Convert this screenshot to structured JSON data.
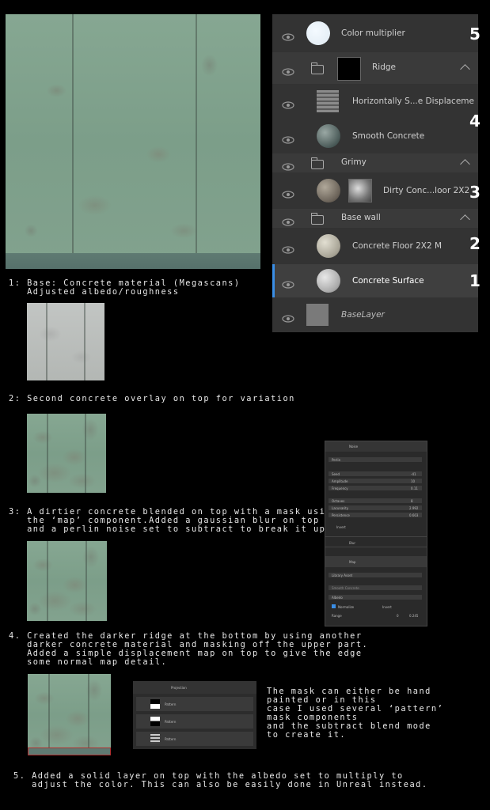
{
  "layers": {
    "color_multiplier": "Color multiplier",
    "ridge": "Ridge",
    "horiz_disp": "Horizontally S...e Displaceme",
    "smooth_concrete": "Smooth Concrete",
    "grimy": "Grimy",
    "dirty_concrete": "Dirty Conc...loor 2X2",
    "base_wall": "Base wall",
    "concrete_floor": "Concrete Floor 2X2 M",
    "concrete_surface": "Concrete Surface",
    "base_layer": "BaseLayer"
  },
  "markers": {
    "m5": "5",
    "m4": "4",
    "m3": "3",
    "m2": "2",
    "m1": "1"
  },
  "steps": {
    "s1": "1: Base: Concrete material (Megascans)\n   Adjusted albedo/roughness",
    "s2": "2: Second concrete overlay on top for variation",
    "s3": "3: A dirtier concrete blended on top with a mask using\n   the ‘map’ component.Added a gaussian blur on top\n   and a perlin noise set to subtract to break it up.",
    "s4": "4. Created the darker ridge at the bottom by using another\n   darker concrete material and masking off the upper part.\n   Added a simple displacement map on top to give the edge\n   some normal map detail.",
    "s4_note": "The mask can either be hand\npainted or in this\ncase I used several ‘pattern’\nmask components\nand the subtract blend mode\nto create it.",
    "s5": "5. Added a solid layer on top with the albedo set to multiply to\n   adjust the color. This can also be easily done in Unreal instead."
  },
  "noise_panel": {
    "title": "Noise",
    "type": "Perlin",
    "seed_label": "Seed",
    "seed_value": "-41",
    "amplitude_label": "Amplitude",
    "amplitude_value": "10",
    "frequency_label": "Frequency",
    "frequency_value": "0.11",
    "octaves_label": "Octaves",
    "octaves_value": "8",
    "lacunarity_label": "Lacunarity",
    "lacunarity_value": "2.992",
    "persistence_label": "Persistence",
    "persistence_value": "0.603",
    "invert_label": "Invert",
    "blur_label": "Blur",
    "map_label": "Map",
    "source": "Library Asset",
    "asset": "Smooth Concrete",
    "channel": "Albedo",
    "normalize_label": "Normalize",
    "invert2_label": "Invert",
    "range_label": "Range",
    "range_min": "0",
    "range_max": "0.245"
  },
  "projection_panel": {
    "title": "Projection",
    "p1": "Pattern",
    "p2": "Pattern",
    "p3": "Pattern"
  },
  "colors": {
    "selection_accent": "#3a8ee6",
    "panel_bg": "#333333",
    "ridge_outline": "#b03030"
  }
}
